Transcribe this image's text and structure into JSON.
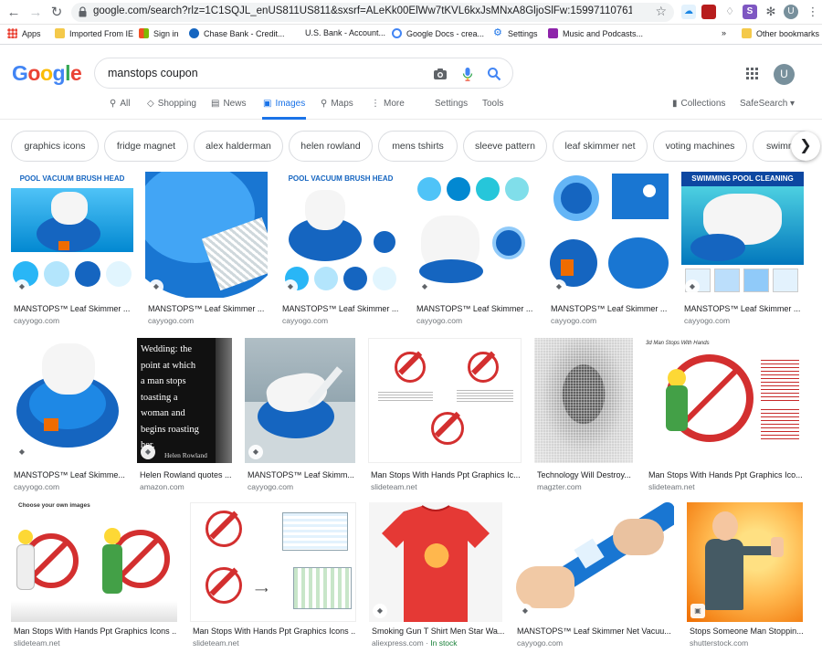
{
  "browser": {
    "url": "google.com/search?rlz=1C1SQJL_enUS811US811&sxsrf=ALeKk00ElWw7tKVL6kxJsMNxA8GljoSlFw:1599711076183&source=univ&tbm...",
    "bookmarks": [
      "Apps",
      "Imported From IE",
      "Sign in",
      "Chase Bank - Credit...",
      "U.S. Bank - Account...",
      "Google Docs - crea...",
      "Settings",
      "Music and Podcasts...",
      "»",
      "Other bookmarks"
    ],
    "avatar_letter": "U"
  },
  "search": {
    "logo_letters": [
      "G",
      "o",
      "o",
      "g",
      "l",
      "e"
    ],
    "query": "manstops coupon"
  },
  "tabs": {
    "all": "All",
    "shopping": "Shopping",
    "news": "News",
    "images": "Images",
    "maps": "Maps",
    "more": "More",
    "settings": "Settings",
    "tools": "Tools",
    "collections": "Collections",
    "safesearch": "SafeSearch ▾"
  },
  "chips": [
    "graphics icons",
    "fridge magnet",
    "alex halderman",
    "helen rowland",
    "mens tshirts",
    "sleeve pattern",
    "leaf skimmer net",
    "voting machines",
    "swimm"
  ],
  "results": {
    "row1": [
      {
        "caption": "MANSTOPS™ Leaf Skimmer ...",
        "source": "cayyogo.com",
        "banner": "POOL VACUUM BRUSH HEAD"
      },
      {
        "caption": "MANSTOPS™ Leaf Skimmer ...",
        "source": "cayyogo.com"
      },
      {
        "caption": "MANSTOPS™ Leaf Skimmer ...",
        "source": "cayyogo.com",
        "banner": "POOL VACUUM BRUSH HEAD"
      },
      {
        "caption": "MANSTOPS™ Leaf Skimmer ...",
        "source": "cayyogo.com"
      },
      {
        "caption": "MANSTOPS™ Leaf Skimmer ...",
        "source": "cayyogo.com"
      },
      {
        "caption": "MANSTOPS™ Leaf Skimmer ...",
        "source": "cayyogo.com",
        "banner": "SWIMMING POOL CLEANING BRUSH"
      }
    ],
    "row2": [
      {
        "caption": "MANSTOPS™ Leaf Skimme...",
        "source": "cayyogo.com"
      },
      {
        "caption": "Helen Rowland quotes ...",
        "source": "amazon.com",
        "quote": [
          "Wedding: the",
          "point at which",
          "a man stops",
          "toasting a",
          "woman and",
          "begins roasting",
          "her."
        ],
        "quote_author": "Helen Rowland"
      },
      {
        "caption": "MANSTOPS™ Leaf Skimm...",
        "source": "cayyogo.com"
      },
      {
        "caption": "Man Stops With Hands Ppt Graphics Ic...",
        "source": "slideteam.net"
      },
      {
        "caption": "Technology Will Destroy...",
        "source": "magzter.com"
      },
      {
        "caption": "Man Stops With Hands Ppt Graphics Ico...",
        "source": "slideteam.net",
        "banner": "3d Man Stops With Hands"
      }
    ],
    "row3": [
      {
        "caption": "Man Stops With Hands Ppt Graphics Icons ...",
        "source": "slideteam.net",
        "banner": "Choose your own images"
      },
      {
        "caption": "Man Stops With Hands Ppt Graphics Icons ...",
        "source": "slideteam.net"
      },
      {
        "caption": "Smoking Gun T Shirt Men Star Wa...",
        "source": "aliexpress.com",
        "stock": "In stock"
      },
      {
        "caption": "MANSTOPS™ Leaf Skimmer Net Vacuu...",
        "source": "cayyogo.com"
      },
      {
        "caption": "Stops Someone Man Stoppin...",
        "source": "shutterstock.com"
      }
    ]
  },
  "colors": {
    "accent": "#1a73e8",
    "blue": "#4285f4",
    "red": "#ea4335",
    "yellow": "#fbbc05",
    "green": "#34a853"
  }
}
